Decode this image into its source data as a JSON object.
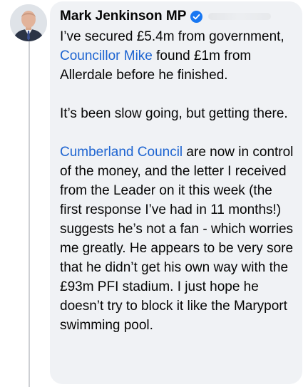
{
  "author": {
    "name": "Mark Jenkinson MP",
    "verified": true,
    "avatar_icon": "profile-photo-icon",
    "verified_icon": "verified-badge-icon"
  },
  "colors": {
    "bubble_bg": "#f0f2f5",
    "link": "#1d64d1",
    "verified": "#1877f2",
    "text": "#050505"
  },
  "comment": {
    "p1": {
      "t1": "I’ve secured £5.4m from government, ",
      "link": "Councillor Mike",
      "t2": " found £1m from Allerdale before he finished."
    },
    "p2": "It’s been slow going, but getting there.",
    "p3": {
      "link": "Cumberland Council",
      "t1": " are now in control of the money, and the letter I received from the Leader on it this week (the first response I’ve had in 11 months!) suggests he’s not a fan - which worries me greatly. He appears to be very sore that he didn’t get his own way with the £93m PFI stadium. I just hope he doesn’t try to block it like the Maryport swimming pool."
    }
  }
}
